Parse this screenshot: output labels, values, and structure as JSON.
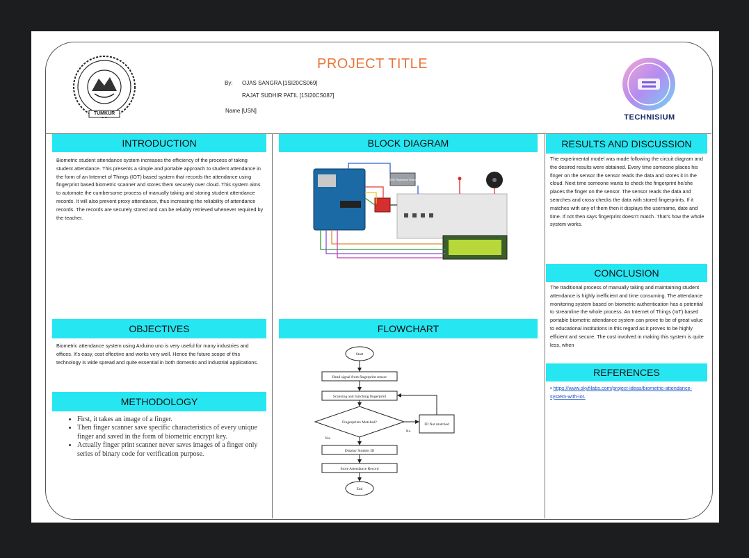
{
  "poster": {
    "title": "PROJECT TITLE",
    "by_label": "By:",
    "authors": [
      "OJAS SANGRA [1SI20CS069]",
      "RAJAT SUDHIR PATIL [1SI20CS087]"
    ],
    "name_usn_label": "Name [USN]",
    "left_logo_text": "TUMKUR",
    "left_logo_ring": "SIDDAGANGA INSTITUTE OF TECHNOLOGY",
    "right_logo_text": "TECHNISIUM"
  },
  "sections": {
    "introduction": {
      "heading": "INTRODUCTION",
      "body": "Biometric student attendance system increases the efficiency of the process of taking student attendance. This presents a simple and portable approach to student attendance in the form of an Internet of Things (IOT) based system that records the attendance using fingerprint based biometric scanner and stores them securely over cloud. This system aims to automate the cumbersome process of manually taking and storing student attendance records. It will also prevent proxy attendance, thus increasing the reliability of attendance records. The records are securely stored and can be reliably retrieved whenever required by the teacher."
    },
    "objectives": {
      "heading": "OBJECTIVES",
      "body": "Biometric attendance system using Arduino uno is very useful for many industries and offices. It's easy, cost effective and works very well. Hence the future scope of this technology is wide spread and quite essential in both domestic and industrial applications."
    },
    "methodology": {
      "heading": "METHODOLOGY",
      "items": [
        "First, it takes an image of a finger.",
        "Then finger scanner save specific characteristics of every unique finger and saved in the form of biometric encrypt key.",
        "Actually finger print scanner never saves images of a finger only series of binary code for verification purpose."
      ]
    },
    "block_diagram": {
      "heading": "BLOCK DIAGRAM",
      "sensor_label": "R305 Fingerprint Sensor"
    },
    "flowchart": {
      "heading": "FLOWCHART",
      "nodes": {
        "start": "Start",
        "read": "Read signal from fingerprint sensor",
        "scan": "Scanning and matching fingerprint",
        "decision": "Fingerprints Matched?",
        "not_matched": "ID Not matched",
        "display": "Display Student ID",
        "store": "Store Attendance Record",
        "end": "End"
      },
      "yes_label": "Yes",
      "no_label": "No"
    },
    "results": {
      "heading": "RESULTS AND DISCUSSION",
      "body": "The experimental model was made following the circuit diagram and the desired results were obtained. Every time someone places his finger on the sensor the sensor reads the data and stores it in the cloud. Next time someone wants to check the fingerprint he/she places the finger on the sensor. The sensor reads the data and searches and cross-checks the data with stored fingerprints. If it matches with any of them then it displays the username, date and time. If not then says fingerprint doesn't match .That's how the whole system works."
    },
    "conclusion": {
      "heading": "CONCLUSION",
      "body": "The traditional process of manually taking and maintaining student attendance is highly inefficient and time consuming. The attendance monitoring system based on biometric authentication has a potential to streamline the whole process. An Internet of Things (IoT) based portable biometric attendance system can prove to be of great value to educational institutions in this regard as it proves to be highly efficient and secure. The cost involved in making this system is quite less, when"
    },
    "references": {
      "heading": "REFERENCES",
      "bullet": "•",
      "link": "https://www.skyfilabs.com/project-ideas/biometric-attendance-system-with-iot."
    }
  },
  "colors": {
    "band": "#26e6f2",
    "title": "#e8743b",
    "background": "#1c1d1f"
  }
}
